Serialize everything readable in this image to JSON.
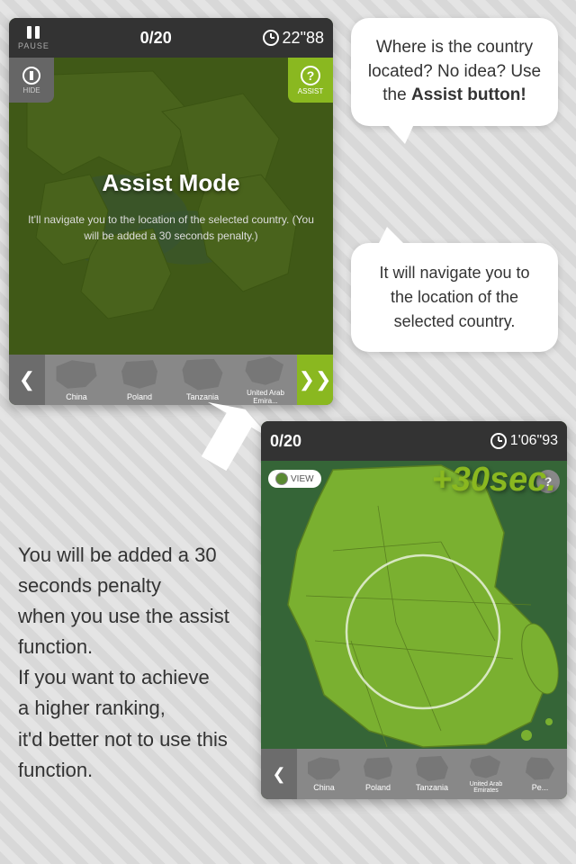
{
  "top_screenshot": {
    "header": {
      "pause_label": "PAUSE",
      "score": "0/20",
      "timer": "22\"88"
    },
    "assist_overlay": {
      "title": "Assist Mode",
      "description": "It'll navigate you to the location of the selected country. (You will be added a 30 seconds penalty.)"
    },
    "hide_label": "HIDE",
    "assist_label": "ASSIST",
    "countries": [
      {
        "name": "China",
        "abbrev": "China"
      },
      {
        "name": "Poland",
        "abbrev": "Poland"
      },
      {
        "name": "Tanzania",
        "abbrev": "Tanzania"
      },
      {
        "name": "United Arab Emirates",
        "abbrev": "United Arab Emira..."
      }
    ]
  },
  "bubble_top": {
    "text_normal": "Where is the country located? No idea? Use the ",
    "text_bold": "Assist button!"
  },
  "bubble_bottom": {
    "text": "It will navigate you to the location of the selected country."
  },
  "bottom_screenshot": {
    "header": {
      "score": "0/20",
      "timer": "1'06\"93"
    },
    "penalty": "+30sec.",
    "view_label": "VIEW",
    "assist_label": "ASSIST",
    "countries": [
      {
        "name": "China",
        "abbrev": "China"
      },
      {
        "name": "Poland",
        "abbrev": "Poland"
      },
      {
        "name": "Tanzania",
        "abbrev": "Tanzania"
      },
      {
        "name": "United Arab Emirates",
        "abbrev": "United Arab Emirates"
      },
      {
        "name": "Peru",
        "abbrev": "Pe..."
      }
    ]
  },
  "left_text": {
    "line1": "You will be added a 30",
    "line2": "seconds penalty",
    "line3": "when you use the assist",
    "line4": "function.",
    "line5": " If you want to achieve",
    "line6": "a higher ranking,",
    "line7": "it'd better not to use this",
    "line8": "function."
  }
}
